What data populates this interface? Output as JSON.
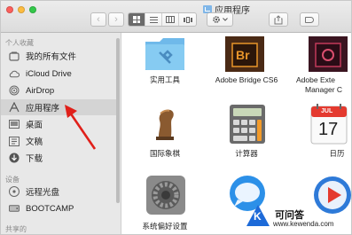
{
  "window": {
    "title": "应用程序",
    "nav_back": "‹",
    "nav_forward": "›"
  },
  "sidebar": {
    "sections": [
      {
        "heading": "个人收藏"
      },
      {
        "heading": "设备"
      },
      {
        "heading": "共享的"
      }
    ],
    "favorites": [
      {
        "label": "我的所有文件",
        "icon": "all-files-icon"
      },
      {
        "label": "iCloud Drive",
        "icon": "cloud-icon"
      },
      {
        "label": "AirDrop",
        "icon": "airdrop-icon"
      },
      {
        "label": "应用程序",
        "icon": "applications-icon",
        "selected": true
      },
      {
        "label": "桌面",
        "icon": "desktop-icon"
      },
      {
        "label": "文稿",
        "icon": "documents-icon"
      },
      {
        "label": "下载",
        "icon": "downloads-icon"
      }
    ],
    "devices": [
      {
        "label": "远程光盘",
        "icon": "remote-disc-icon"
      },
      {
        "label": "BOOTCAMP",
        "icon": "drive-icon"
      }
    ]
  },
  "apps": [
    {
      "label": "实用工具",
      "icon": "utilities-folder-icon"
    },
    {
      "label": "Adobe Bridge CS6",
      "icon": "adobe-bridge-icon",
      "icon_text": "Br"
    },
    {
      "label": "Adobe Exte",
      "label2": "Manager C",
      "icon": "adobe-extension-manager-icon"
    },
    {
      "label": "国际象棋",
      "icon": "chess-icon"
    },
    {
      "label": "计算器",
      "icon": "calculator-icon"
    },
    {
      "label": "日历",
      "icon": "calendar-icon",
      "icon_month": "JUL",
      "icon_day": "17"
    },
    {
      "label": "系统偏好设置",
      "icon": "system-preferences-icon"
    },
    {
      "label": "",
      "icon": "messages-icon"
    },
    {
      "label": "",
      "icon": "video-player-icon"
    }
  ],
  "watermark": {
    "brand": "可问答",
    "url": "www.kewenda.com",
    "letter": "K"
  },
  "colors": {
    "sidebar_bg": "#e8e8e8",
    "selected_bg": "#d4d4d4",
    "folder_blue": "#7fc4ef",
    "bridge_brown": "#4a2a15",
    "bridge_orange": "#e8952a",
    "arrow_red": "#e0201a"
  }
}
